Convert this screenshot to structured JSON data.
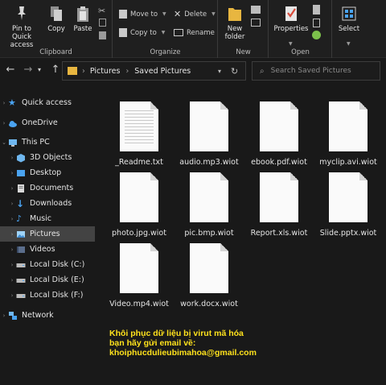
{
  "ribbon": {
    "clipboard": {
      "label": "Clipboard",
      "pin_label_1": "Pin to Quick",
      "pin_label_2": "access",
      "copy": "Copy",
      "paste": "Paste"
    },
    "organize": {
      "label": "Organize",
      "move_to": "Move to",
      "copy_to": "Copy to",
      "delete": "Delete",
      "rename": "Rename"
    },
    "new": {
      "label": "New",
      "new_folder_1": "New",
      "new_folder_2": "folder"
    },
    "open": {
      "label": "Open",
      "properties": "Properties"
    },
    "select": {
      "select": "Select"
    }
  },
  "address": {
    "segments": [
      "Pictures",
      "Saved Pictures"
    ]
  },
  "search": {
    "placeholder": "Search Saved Pictures"
  },
  "nav": {
    "items": [
      {
        "label": "Quick access",
        "icon": "star-icon"
      },
      {
        "label": "OneDrive",
        "icon": "cloud-icon"
      },
      {
        "label": "This PC",
        "icon": "pc-icon"
      },
      {
        "label": "3D Objects",
        "icon": "cube-icon"
      },
      {
        "label": "Desktop",
        "icon": "desktop-icon"
      },
      {
        "label": "Documents",
        "icon": "documents-icon"
      },
      {
        "label": "Downloads",
        "icon": "download-icon"
      },
      {
        "label": "Music",
        "icon": "music-icon"
      },
      {
        "label": "Pictures",
        "icon": "pictures-icon"
      },
      {
        "label": "Videos",
        "icon": "videos-icon"
      },
      {
        "label": "Local Disk (C:)",
        "icon": "drive-icon"
      },
      {
        "label": "Local Disk (E:)",
        "icon": "drive-icon"
      },
      {
        "label": "Local Disk (F:)",
        "icon": "drive-icon"
      },
      {
        "label": "Network",
        "icon": "network-icon"
      }
    ]
  },
  "files": [
    "_Readme.txt",
    "audio.mp3.wiot",
    "ebook.pdf.wiot",
    "myclip.avi.wiot",
    "photo.jpg.wiot",
    "pic.bmp.wiot",
    "Report.xls.wiot",
    "Slide.pptx.wiot",
    "Video.mp4.wiot",
    "work.docx.wiot"
  ],
  "ransom_note": {
    "line1": "Khôi phục dữ liệu bị virut mã hóa",
    "line2": "bạn hãy gửi email về:",
    "line3": "khoiphucdulieubimahoa@gmail.com"
  },
  "colors": {
    "background": "#191919",
    "selected": "#434343",
    "note": "#ffe21c",
    "folder": "#e8b640",
    "accent": "#4aa3f0"
  }
}
